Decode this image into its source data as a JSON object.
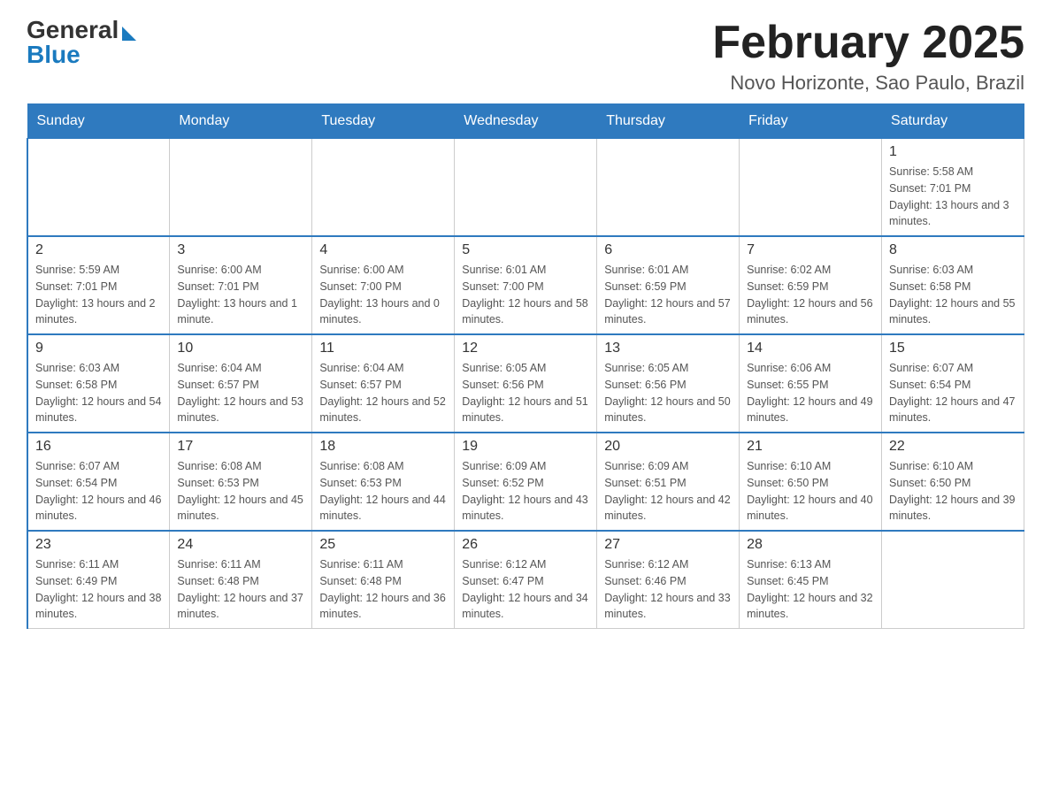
{
  "header": {
    "logo_general": "General",
    "logo_blue": "Blue",
    "calendar_title": "February 2025",
    "location": "Novo Horizonte, Sao Paulo, Brazil"
  },
  "weekdays": [
    "Sunday",
    "Monday",
    "Tuesday",
    "Wednesday",
    "Thursday",
    "Friday",
    "Saturday"
  ],
  "weeks": [
    {
      "days": [
        {
          "number": "",
          "info": ""
        },
        {
          "number": "",
          "info": ""
        },
        {
          "number": "",
          "info": ""
        },
        {
          "number": "",
          "info": ""
        },
        {
          "number": "",
          "info": ""
        },
        {
          "number": "",
          "info": ""
        },
        {
          "number": "1",
          "info": "Sunrise: 5:58 AM\nSunset: 7:01 PM\nDaylight: 13 hours and 3 minutes."
        }
      ]
    },
    {
      "days": [
        {
          "number": "2",
          "info": "Sunrise: 5:59 AM\nSunset: 7:01 PM\nDaylight: 13 hours and 2 minutes."
        },
        {
          "number": "3",
          "info": "Sunrise: 6:00 AM\nSunset: 7:01 PM\nDaylight: 13 hours and 1 minute."
        },
        {
          "number": "4",
          "info": "Sunrise: 6:00 AM\nSunset: 7:00 PM\nDaylight: 13 hours and 0 minutes."
        },
        {
          "number": "5",
          "info": "Sunrise: 6:01 AM\nSunset: 7:00 PM\nDaylight: 12 hours and 58 minutes."
        },
        {
          "number": "6",
          "info": "Sunrise: 6:01 AM\nSunset: 6:59 PM\nDaylight: 12 hours and 57 minutes."
        },
        {
          "number": "7",
          "info": "Sunrise: 6:02 AM\nSunset: 6:59 PM\nDaylight: 12 hours and 56 minutes."
        },
        {
          "number": "8",
          "info": "Sunrise: 6:03 AM\nSunset: 6:58 PM\nDaylight: 12 hours and 55 minutes."
        }
      ]
    },
    {
      "days": [
        {
          "number": "9",
          "info": "Sunrise: 6:03 AM\nSunset: 6:58 PM\nDaylight: 12 hours and 54 minutes."
        },
        {
          "number": "10",
          "info": "Sunrise: 6:04 AM\nSunset: 6:57 PM\nDaylight: 12 hours and 53 minutes."
        },
        {
          "number": "11",
          "info": "Sunrise: 6:04 AM\nSunset: 6:57 PM\nDaylight: 12 hours and 52 minutes."
        },
        {
          "number": "12",
          "info": "Sunrise: 6:05 AM\nSunset: 6:56 PM\nDaylight: 12 hours and 51 minutes."
        },
        {
          "number": "13",
          "info": "Sunrise: 6:05 AM\nSunset: 6:56 PM\nDaylight: 12 hours and 50 minutes."
        },
        {
          "number": "14",
          "info": "Sunrise: 6:06 AM\nSunset: 6:55 PM\nDaylight: 12 hours and 49 minutes."
        },
        {
          "number": "15",
          "info": "Sunrise: 6:07 AM\nSunset: 6:54 PM\nDaylight: 12 hours and 47 minutes."
        }
      ]
    },
    {
      "days": [
        {
          "number": "16",
          "info": "Sunrise: 6:07 AM\nSunset: 6:54 PM\nDaylight: 12 hours and 46 minutes."
        },
        {
          "number": "17",
          "info": "Sunrise: 6:08 AM\nSunset: 6:53 PM\nDaylight: 12 hours and 45 minutes."
        },
        {
          "number": "18",
          "info": "Sunrise: 6:08 AM\nSunset: 6:53 PM\nDaylight: 12 hours and 44 minutes."
        },
        {
          "number": "19",
          "info": "Sunrise: 6:09 AM\nSunset: 6:52 PM\nDaylight: 12 hours and 43 minutes."
        },
        {
          "number": "20",
          "info": "Sunrise: 6:09 AM\nSunset: 6:51 PM\nDaylight: 12 hours and 42 minutes."
        },
        {
          "number": "21",
          "info": "Sunrise: 6:10 AM\nSunset: 6:50 PM\nDaylight: 12 hours and 40 minutes."
        },
        {
          "number": "22",
          "info": "Sunrise: 6:10 AM\nSunset: 6:50 PM\nDaylight: 12 hours and 39 minutes."
        }
      ]
    },
    {
      "days": [
        {
          "number": "23",
          "info": "Sunrise: 6:11 AM\nSunset: 6:49 PM\nDaylight: 12 hours and 38 minutes."
        },
        {
          "number": "24",
          "info": "Sunrise: 6:11 AM\nSunset: 6:48 PM\nDaylight: 12 hours and 37 minutes."
        },
        {
          "number": "25",
          "info": "Sunrise: 6:11 AM\nSunset: 6:48 PM\nDaylight: 12 hours and 36 minutes."
        },
        {
          "number": "26",
          "info": "Sunrise: 6:12 AM\nSunset: 6:47 PM\nDaylight: 12 hours and 34 minutes."
        },
        {
          "number": "27",
          "info": "Sunrise: 6:12 AM\nSunset: 6:46 PM\nDaylight: 12 hours and 33 minutes."
        },
        {
          "number": "28",
          "info": "Sunrise: 6:13 AM\nSunset: 6:45 PM\nDaylight: 12 hours and 32 minutes."
        },
        {
          "number": "",
          "info": ""
        }
      ]
    }
  ]
}
